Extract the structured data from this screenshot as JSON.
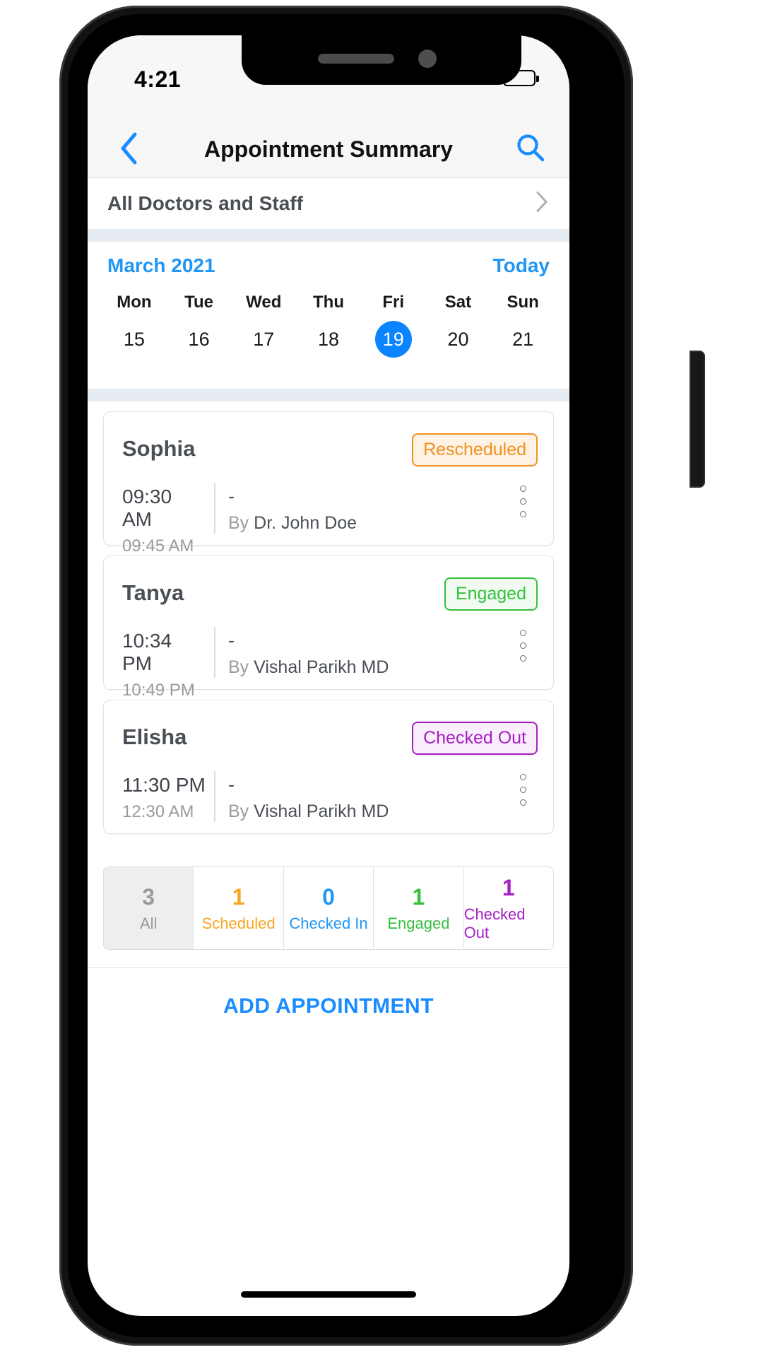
{
  "status_bar": {
    "time": "4:21",
    "wifi_icon": "wifi-icon",
    "battery_icon": "battery-full-icon",
    "signal_icon": "signal-dots-icon"
  },
  "nav": {
    "back_icon": "chevron-left-icon",
    "title": "Appointment Summary",
    "search_icon": "search-icon"
  },
  "filter": {
    "label": "All Doctors and Staff",
    "chevron_icon": "chevron-right-icon"
  },
  "calendar": {
    "month": "March 2021",
    "today_label": "Today",
    "weekdays": [
      "Mon",
      "Tue",
      "Wed",
      "Thu",
      "Fri",
      "Sat",
      "Sun"
    ],
    "dates": [
      "15",
      "16",
      "17",
      "18",
      "19",
      "20",
      "21"
    ],
    "selected_index": 4,
    "selected_color": "#0a84ff"
  },
  "appointments": [
    {
      "name": "Sophia",
      "status": "Rescheduled",
      "status_color": "#f29020",
      "status_bg": "#fdf2e4",
      "time_start": "09:30 AM",
      "time_end": "09:45 AM",
      "detail": "-",
      "by_word": "By",
      "by_name": "Dr. John Doe",
      "menu_icon": "kebab-menu-icon"
    },
    {
      "name": "Tanya",
      "status": "Engaged",
      "status_color": "#35c03f",
      "status_bg": "#f1fbf1",
      "time_start": "10:34 PM",
      "time_end": "10:49 PM",
      "detail": "-",
      "by_word": "By",
      "by_name": "Vishal Parikh MD",
      "menu_icon": "kebab-menu-icon"
    },
    {
      "name": "Elisha",
      "status": "Checked Out",
      "status_color": "#a61fc4",
      "status_bg": "#faeefd",
      "time_start": "11:30 PM",
      "time_end": "12:30 AM",
      "detail": "-",
      "by_word": "By",
      "by_name": "Vishal Parikh MD",
      "menu_icon": "kebab-menu-icon"
    }
  ],
  "counters": [
    {
      "count": "3",
      "label": "All",
      "color": "#9a9a9a",
      "active": true
    },
    {
      "count": "1",
      "label": "Scheduled",
      "color": "#f5a623",
      "active": false
    },
    {
      "count": "0",
      "label": "Checked In",
      "color": "#2196f3",
      "active": false
    },
    {
      "count": "1",
      "label": "Engaged",
      "color": "#35c03f",
      "active": false
    },
    {
      "count": "1",
      "label": "Checked Out",
      "color": "#a61fc4",
      "active": false
    }
  ],
  "footer": {
    "add_appointment_label": "ADD APPOINTMENT"
  }
}
